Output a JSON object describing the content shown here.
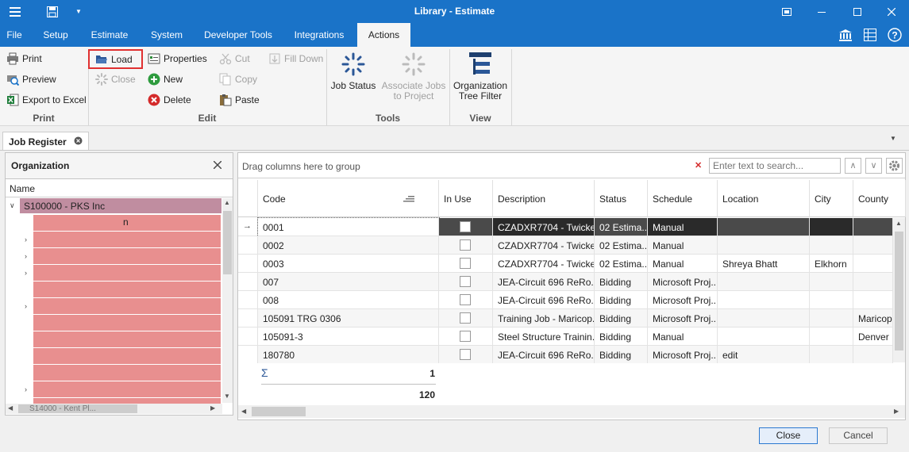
{
  "window": {
    "title": "Library - Estimate"
  },
  "menu": [
    "File",
    "Setup",
    "Estimate",
    "System",
    "Developer Tools",
    "Integrations",
    "Actions"
  ],
  "ribbon": {
    "print": {
      "print": "Print",
      "preview": "Preview",
      "export": "Export to Excel",
      "group": "Print"
    },
    "edit": {
      "load": "Load",
      "close": "Close",
      "properties": "Properties",
      "new": "New",
      "delete": "Delete",
      "cut": "Cut",
      "copy": "Copy",
      "paste": "Paste",
      "filldown": "Fill Down",
      "group": "Edit"
    },
    "tools": {
      "jobstatus": "Job Status",
      "assoc1": "Associate Jobs",
      "assoc2": "to Project",
      "group": "Tools"
    },
    "view": {
      "org1": "Organization",
      "org2": "Tree Filter",
      "group": "View"
    }
  },
  "doc_tab": "Job Register",
  "org_panel": {
    "title": "Organization",
    "col": "Name",
    "root": "S100000 - PKS Inc",
    "first_child_suffix": "n",
    "bottom_partial": "S14000 - Kent Pl..."
  },
  "grid": {
    "drag_hint": "Drag columns here to group",
    "search_placeholder": "Enter text to search...",
    "columns": [
      "Code",
      "In Use",
      "Description",
      "Status",
      "Schedule",
      "Location",
      "City",
      "County"
    ],
    "rows": [
      [
        "0001",
        "",
        "CZADXR7704 - Twicke...",
        "02 Estima...",
        "Manual",
        "",
        "",
        ""
      ],
      [
        "0002",
        "",
        "CZADXR7704 - Twicke...",
        "02 Estima...",
        "Manual",
        "",
        "",
        ""
      ],
      [
        "0003",
        "",
        "CZADXR7704 - Twicke...",
        "02 Estima...",
        "Manual",
        "Shreya Bhatt",
        "Elkhorn",
        ""
      ],
      [
        "007",
        "",
        "JEA-Circuit 696 ReRo...",
        "Bidding",
        "Microsoft Proj...",
        "",
        "",
        ""
      ],
      [
        "008",
        "",
        "JEA-Circuit 696 ReRo...",
        "Bidding",
        "Microsoft Proj...",
        "",
        "",
        ""
      ],
      [
        "105091 TRG 0306",
        "",
        "Training Job - Maricop...",
        "Bidding",
        "Microsoft Proj...",
        "",
        "",
        "Maricopa"
      ],
      [
        "105091-3",
        "",
        "Steel Structure Trainin...",
        "Bidding",
        "Manual",
        "",
        "",
        "Denver"
      ],
      [
        "180780",
        "",
        "JEA-Circuit 696 ReRo...",
        "Bidding",
        "Microsoft Proj...",
        "edit",
        "",
        ""
      ]
    ],
    "summary_value": "1",
    "total_value": "120"
  },
  "footer": {
    "close": "Close",
    "cancel": "Cancel"
  }
}
